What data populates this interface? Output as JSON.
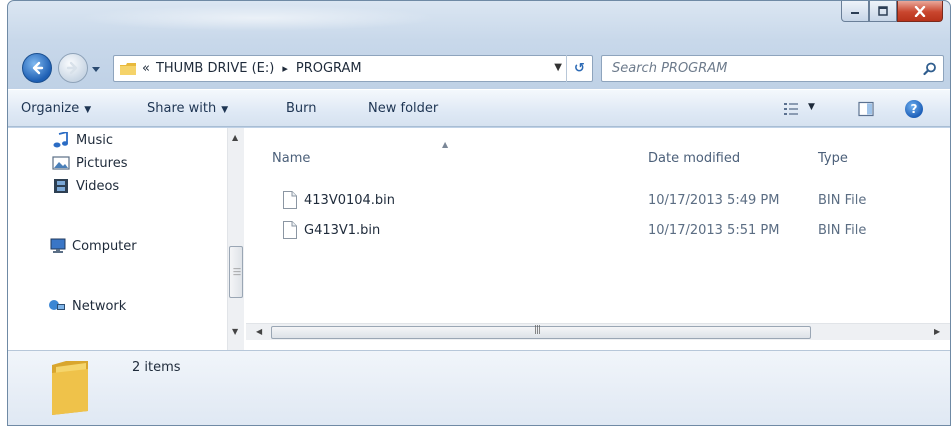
{
  "window": {
    "caption_buttons": [
      "minimize",
      "maximize",
      "close"
    ]
  },
  "address": {
    "overflow": "«",
    "crumbs": [
      "THUMB DRIVE (E:)",
      "PROGRAM"
    ],
    "separator": "▸"
  },
  "search": {
    "placeholder": "Search PROGRAM"
  },
  "toolbar": {
    "organize": "Organize",
    "share_with": "Share with",
    "burn": "Burn",
    "new_folder": "New folder"
  },
  "nav_pane": {
    "items": [
      {
        "label": "Music",
        "icon": "music-icon"
      },
      {
        "label": "Pictures",
        "icon": "pictures-icon"
      },
      {
        "label": "Videos",
        "icon": "videos-icon"
      },
      {
        "label": "Computer",
        "icon": "computer-icon"
      },
      {
        "label": "Network",
        "icon": "network-icon"
      }
    ]
  },
  "file_list": {
    "columns": [
      "Name",
      "Date modified",
      "Type"
    ],
    "rows": [
      {
        "name": "413V0104.bin",
        "date": "10/17/2013 5:49 PM",
        "type": "BIN File"
      },
      {
        "name": "G413V1.bin",
        "date": "10/17/2013 5:51 PM",
        "type": "BIN File"
      }
    ]
  },
  "details": {
    "item_count": "2 items"
  },
  "colors": {
    "accent": "#1e5fb4",
    "close_button": "#c9462e",
    "folder": "#f2c94c"
  }
}
